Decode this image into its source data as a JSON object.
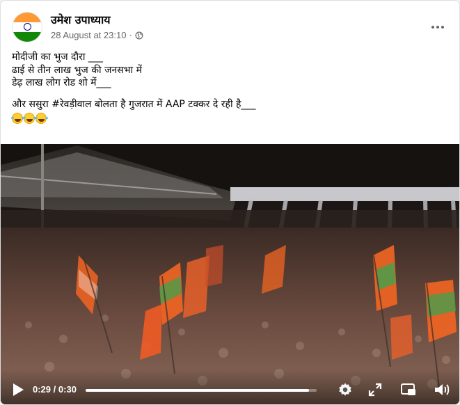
{
  "post": {
    "author": "उमेश उपाध्याय",
    "timestamp": "28 August at 23:10",
    "separator": "·",
    "privacy_icon": "globe-icon",
    "more_icon": "more-options-icon",
    "text_lines": [
      "मोदीजी का भुज दौरा ___",
      "ढाई से तीन लाख भुज की जनसभा में",
      "डेढ़ लाख लोग रोड शो में___"
    ],
    "text_line_2": "और ससुरा #रेवड़ीवाल बोलता है गुजरात में AAP टक्कर दे रही है___",
    "emoji_count": 3,
    "emoji_name": "rolling-on-floor-laughing"
  },
  "video": {
    "current_time": "0:29",
    "separator": "/",
    "duration": "0:30",
    "progress_fraction": 0.967,
    "controls": [
      "play-icon",
      "settings-icon",
      "expand-icon",
      "picture-in-picture-icon",
      "volume-icon"
    ]
  },
  "colors": {
    "flag_saffron": "#ff9933",
    "flag_green": "#138808",
    "bjp_orange": "#f26522",
    "meta_gray": "#65676b"
  }
}
